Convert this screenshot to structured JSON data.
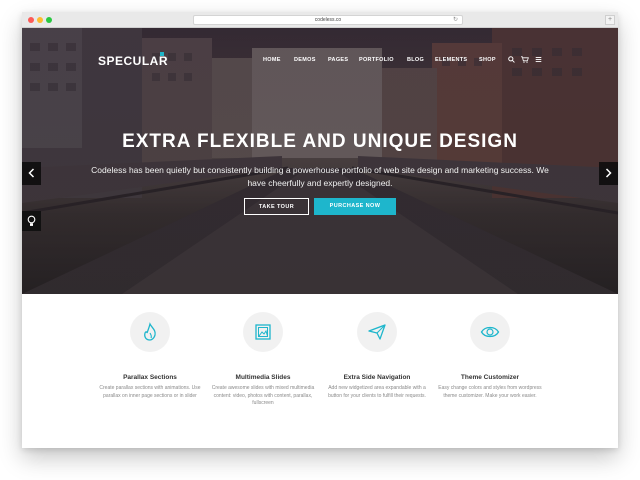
{
  "browser": {
    "url": "codeless.co"
  },
  "site": {
    "logo": "SPECULAR",
    "nav": [
      "HOME",
      "DEMOS",
      "PAGES",
      "PORTFOLIO",
      "BLOG",
      "ELEMENTS",
      "SHOP"
    ]
  },
  "hero": {
    "headline": "EXTRA FLEXIBLE AND UNIQUE DESIGN",
    "subtext": "Codeless has been quietly but consistently building a powerhouse portfolio of web site design and marketing success. We have cheerfully and expertly designed.",
    "buttons": {
      "tour": "TAKE TOUR",
      "purchase": "PURCHASE NOW"
    }
  },
  "features": [
    {
      "title": "Parallax Sections",
      "desc": "Create parallax sections with animations. Use parallax on inner page sections or in slider",
      "icon": "flame-icon"
    },
    {
      "title": "Multimedia Slides",
      "desc": "Create awesome slides with mixed multimedia content: video, photos with content, parallax, fullscreen",
      "icon": "image-icon"
    },
    {
      "title": "Extra Side Navigation",
      "desc": "Add new widgetized area expandable with a button for your clients to fulfill their requests.",
      "icon": "paper-plane-icon"
    },
    {
      "title": "Theme Customizer",
      "desc": "Easy change colors and styles from wordpress theme customizer. Make your work easier.",
      "icon": "eye-icon"
    }
  ],
  "colors": {
    "accent": "#1eb6cc"
  }
}
